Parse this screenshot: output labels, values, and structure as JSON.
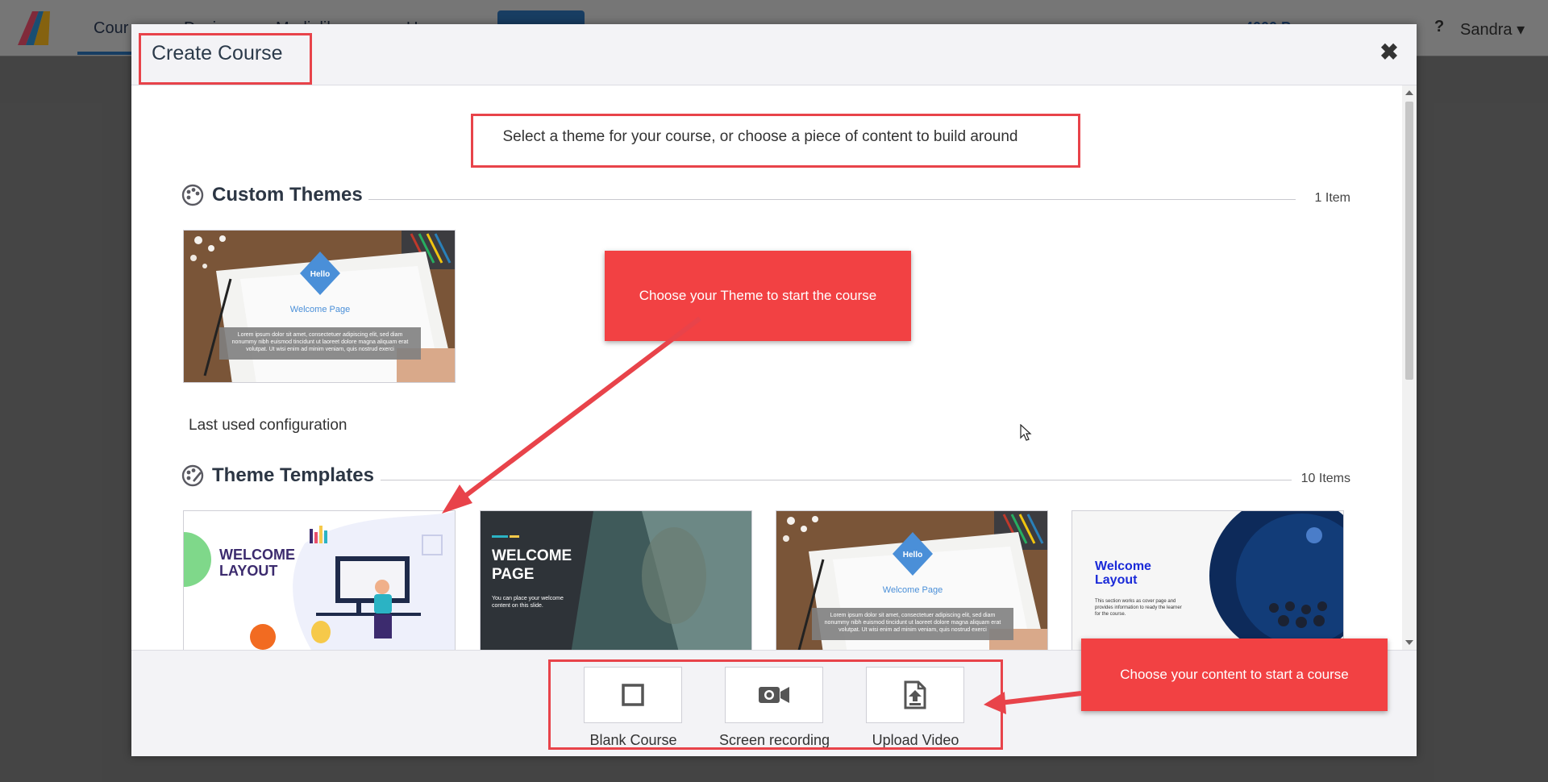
{
  "app": {
    "nav_tabs": [
      "Cour",
      "Desi",
      "Medialib",
      "Users"
    ],
    "credits": "4000 Pr",
    "help": "?",
    "user_name": "Sandra",
    "user_chevron": "▾"
  },
  "modal": {
    "title": "Create Course",
    "close_glyph": "✖",
    "intro": "Select a theme for your course, or choose a piece of content to build around"
  },
  "custom_themes": {
    "title": "Custom Themes",
    "count": "1 Item",
    "items": [
      {
        "caption": "Last used configuration",
        "badge": "Hello",
        "page_label": "Welcome Page",
        "lorem": "Lorem ipsum dolor sit amet, consectetuer adipiscing elit, sed diam nonummy nibh euismod tincidunt ut laoreet dolore magna aliquam erat volutpat. Ut wisi enim ad minim veniam, quis nostrud exerci"
      }
    ]
  },
  "theme_templates": {
    "title": "Theme Templates",
    "count": "10 Items",
    "items": [
      {
        "line1": "WELCOME",
        "line2": "LAYOUT"
      },
      {
        "line1": "WELCOME",
        "line2": "PAGE",
        "sub": "You can place your welcome content on this slide."
      },
      {
        "badge": "Hello",
        "page_label": "Welcome Page",
        "lorem": "Lorem ipsum dolor sit amet, consectetuer adipiscing elit, sed diam nonummy nibh euismod tincidunt ut laoreet dolore magna aliquam erat volutpat. Ut wisi enim ad minim veniam, quis nostrud exerci"
      },
      {
        "line1": "Welcome",
        "line2": "Layout",
        "sub": "This section works as cover page and provides information to ready the learner for the course."
      }
    ]
  },
  "callouts": {
    "theme": "Choose your Theme to start the course",
    "content": "Choose your content to start a course"
  },
  "content_options": [
    {
      "label": "Blank Course",
      "icon": "square-icon"
    },
    {
      "label": "Screen recording",
      "icon": "video-camera-icon"
    },
    {
      "label": "Upload Video",
      "icon": "upload-file-icon"
    }
  ],
  "colors": {
    "accent": "#2d6fb3",
    "annotation": "#e8434a",
    "callout": "#f24143"
  }
}
